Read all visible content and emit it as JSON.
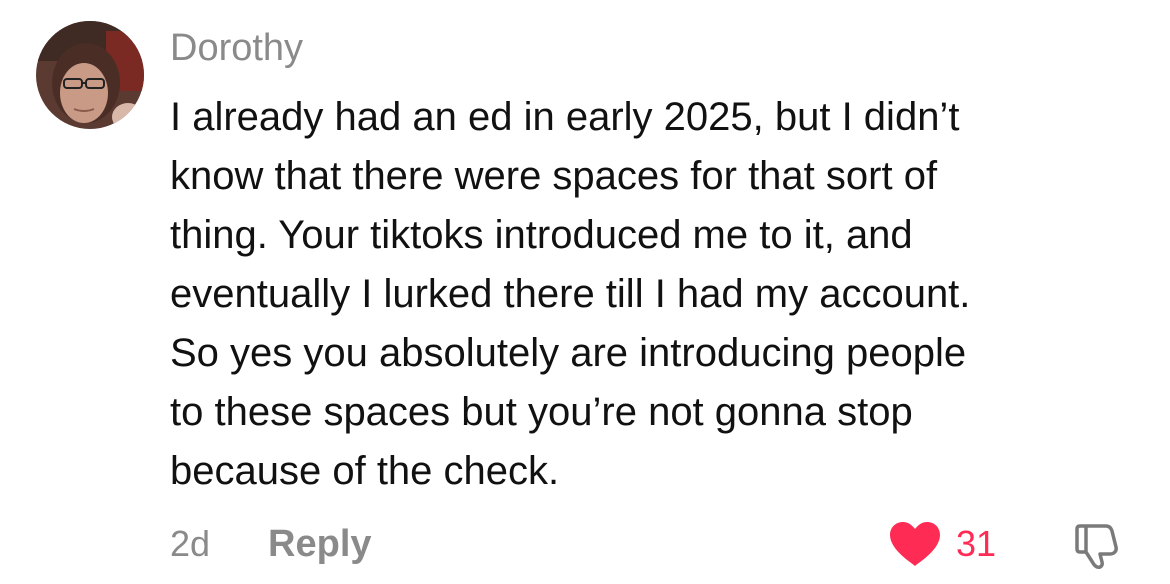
{
  "comment": {
    "username": "Dorothy",
    "text_lines": [
      "I already had an ed in early 2025, but I didn’t",
      "know that there were spaces for that sort of",
      "thing. Your tiktoks introduced me to it, and",
      "eventually I lurked there till I had my account.",
      "So yes you absolutely are introducing people",
      "to these spaces but you’re not gonna stop",
      "because of the check."
    ],
    "timestamp": "2d",
    "reply_label": "Reply",
    "like_count": "31",
    "liked": true
  },
  "icons": {
    "like": "heart-icon",
    "dislike": "thumbs-down-icon"
  },
  "colors": {
    "like_accent": "#fe2c55",
    "secondary_text": "#8a8a8a",
    "primary_text": "#111111"
  }
}
